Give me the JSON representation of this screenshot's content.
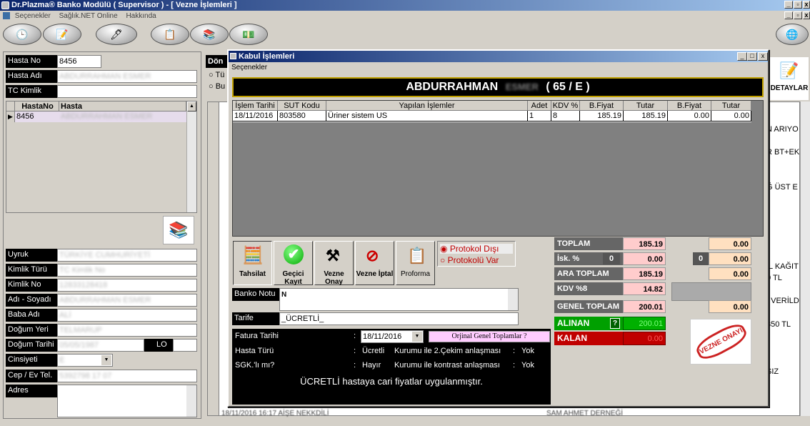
{
  "app": {
    "title": "Dr.Plazma® Banko Modülü ( Supervisor ) - [ Vezne İşlemleri ]",
    "menu": [
      "Seçenekler",
      "Sağlık.NET Online",
      "Hakkında"
    ]
  },
  "left": {
    "hasta_no_label": "Hasta No",
    "hasta_no": "8456",
    "hasta_adi_label": "Hasta Adı",
    "hasta_adi": "ABDURRAHMAN ESMER",
    "tc_label": "TC Kimlik",
    "grid_headers": [
      "HastaNo",
      "Hasta"
    ],
    "grid_row": {
      "no": "8456",
      "name": "ABDURRAHMAN ESMER"
    },
    "fields": [
      {
        "label": "Uyruk",
        "value": "TÜRKİYE CUMHURİYETİ"
      },
      {
        "label": "Kimlik Türü",
        "value": "TC Kimlik No"
      },
      {
        "label": "Kimlik No",
        "value": "12833128418"
      },
      {
        "label": "Adı - Soyadı",
        "value": "ABDURRAHMAN ESMER"
      },
      {
        "label": "Baba Adı",
        "value": "ALİ"
      },
      {
        "label": "Doğum Yeri",
        "value": "TELMARUP"
      },
      {
        "label": "Doğum Tarihi",
        "value": "05/05/1987"
      },
      {
        "label": "Cinsiyeti",
        "value": "E"
      },
      {
        "label": "Cep / Ev Tel.",
        "value": "5392798 17 07"
      },
      {
        "label": "Adres",
        "value": ""
      }
    ],
    "lo_label": "LO"
  },
  "bg": {
    "don_label": "Dön",
    "radio1": "Tü",
    "radio2": "Bu",
    "detaylar": "DETAYLAR",
    "right_texts": [
      "N ARIYO",
      "R BT+EK",
      "Ğ ÜST E",
      "İL KAĞIT",
      "0 TL",
      "İ VERİLD",
      "350 TL",
      "SIZ"
    ],
    "bottom_rows": [
      "18/11/2016  16:17  AİŞE NEKKDİLİ",
      "SAM AHMET DERNEĞİ"
    ]
  },
  "dialog": {
    "title": "Kabul İşlemleri",
    "menu": "Seçenekler",
    "patient_name": "ABDURRAHMAN",
    "patient_surname": "ESMER",
    "patient_suffix": "( 65 / E )",
    "table_headers": [
      "İşlem Tarihi",
      "SUT Kodu",
      "Yapılan İşlemler",
      "Adet",
      "KDV %",
      "B.Fiyat",
      "Tutar",
      "B.Fiyat",
      "Tutar"
    ],
    "table_rows": [
      [
        "18/11/2016",
        "803580",
        "Üriner sistem US",
        "1",
        "8",
        "185.19",
        "185.19",
        "0.00",
        "0.00"
      ]
    ],
    "buttons": {
      "tahsilat": "Tahsilat",
      "gecici": "Geçici Kayıt",
      "vezne_onay": "Vezne Onay",
      "vezne_iptal": "Vezne İptal",
      "proforma": "Proforma"
    },
    "radio_protokol_disi": "Protokol Dışı",
    "radio_protokollu": "Protokolü Var",
    "banko_notu_label": "Banko Notu",
    "banko_notu": "N",
    "tarife_label": "Tarife",
    "tarife": "_ÜCRETLİ_",
    "fatura_label": "Fatura Tarihi",
    "fatura_tarihi": "18/11/2016",
    "orjinal_btn": "Orjinal Genel Toplamlar ?",
    "hasta_turu_label": "Hasta Türü",
    "hasta_turu": "Ücretli",
    "kurum_cekim_label": "Kurumu ile 2.Çekim anlaşması",
    "kurum_cekim": "Yok",
    "sgk_label": "SGK.'lı mı?",
    "sgk": "Hayır",
    "kurum_kontrast_label": "Kurumu ile kontrast anlaşması",
    "kurum_kontrast": "Yok",
    "message": "ÜCRETLİ hastaya cari fiyatlar uygulanmıştır.",
    "colon": ":",
    "summary": {
      "toplam_label": "TOPLAM",
      "toplam": "185.19",
      "toplam2": "0.00",
      "isk_label": "İsk. %",
      "isk_pct": "0",
      "isk": "0.00",
      "isk_pct2": "0",
      "isk2": "0.00",
      "ara_label": "ARA TOPLAM",
      "ara": "185.19",
      "ara2": "0.00",
      "kdv_label": "KDV %8",
      "kdv": "14.82",
      "genel_label": "GENEL TOPLAM",
      "genel": "200.01",
      "genel2": "0.00",
      "alinan_label": "ALINAN",
      "alinan_q": "?",
      "alinan": "200.01",
      "kalan_label": "KALAN",
      "kalan": "0.00"
    },
    "stamp": "VEZNE ONAYI"
  },
  "colors": {
    "title_start": "#0a246a",
    "title_end": "#a6caf0",
    "alinan": "#00a000",
    "kalan": "#c00000",
    "protokol": "#c00000"
  }
}
